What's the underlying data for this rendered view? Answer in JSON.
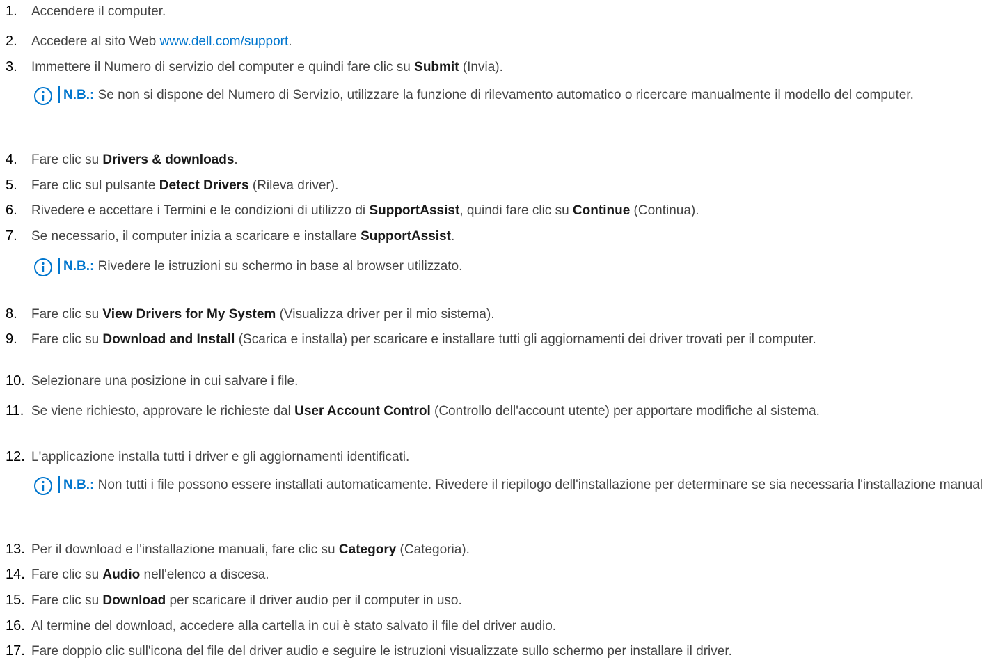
{
  "steps": [
    {
      "num": "1.",
      "segments": [
        {
          "t": "Accendere il computer."
        }
      ]
    },
    {
      "num": "2.",
      "segments": [
        {
          "t": "Accedere al sito Web "
        },
        {
          "t": "www.dell.com/support",
          "link": true
        },
        {
          "t": "."
        }
      ]
    },
    {
      "num": "3.",
      "segments": [
        {
          "t": "Immettere il Numero di servizio del computer e quindi fare clic su "
        },
        {
          "t": "Submit",
          "b": true
        },
        {
          "t": " (Invia)."
        }
      ],
      "note": {
        "label": "N.B.:",
        "text": " Se non si dispone del Numero di Servizio, utilizzare la funzione di rilevamento automatico o ricercare manualmente il modello del computer."
      }
    },
    {
      "num": "4.",
      "segments": [
        {
          "t": "Fare clic su "
        },
        {
          "t": "Drivers & downloads",
          "b": true
        },
        {
          "t": "."
        }
      ]
    },
    {
      "num": "5.",
      "segments": [
        {
          "t": "Fare clic sul pulsante "
        },
        {
          "t": "Detect Drivers",
          "b": true
        },
        {
          "t": " (Rileva driver)."
        }
      ]
    },
    {
      "num": "6.",
      "segments": [
        {
          "t": "Rivedere e accettare i Termini e le condizioni di utilizzo di "
        },
        {
          "t": "SupportAssist",
          "b": true
        },
        {
          "t": ", quindi fare clic su "
        },
        {
          "t": "Continue",
          "b": true
        },
        {
          "t": " (Continua)."
        }
      ]
    },
    {
      "num": "7.",
      "segments": [
        {
          "t": "Se necessario, il computer inizia a scaricare e installare "
        },
        {
          "t": "SupportAssist",
          "b": true
        },
        {
          "t": "."
        }
      ],
      "note": {
        "label": "N.B.:",
        "text": " Rivedere le istruzioni su schermo in base al browser utilizzato."
      }
    },
    {
      "num": "8.",
      "segments": [
        {
          "t": "Fare clic su "
        },
        {
          "t": "View Drivers for My System",
          "b": true
        },
        {
          "t": " (Visualizza driver per il mio sistema)."
        }
      ]
    },
    {
      "num": "9.",
      "segments": [
        {
          "t": "Fare clic su "
        },
        {
          "t": "Download and Install",
          "b": true
        },
        {
          "t": " (Scarica e installa) per scaricare e installare tutti gli aggiornamenti dei driver trovati per il computer."
        }
      ]
    },
    {
      "num": "10.",
      "segments": [
        {
          "t": "Selezionare una posizione in cui salvare i file."
        }
      ]
    },
    {
      "num": "11.",
      "segments": [
        {
          "t": "Se viene richiesto, approvare le richieste dal "
        },
        {
          "t": "User Account Control",
          "b": true
        },
        {
          "t": " (Controllo dell'account utente) per apportare modifiche al sistema."
        }
      ]
    },
    {
      "num": "12.",
      "segments": [
        {
          "t": "L'applicazione installa tutti i driver e gli aggiornamenti identificati."
        }
      ],
      "note": {
        "label": "N.B.:",
        "text": " Non tutti i file possono essere installati automaticamente. Rivedere il riepilogo dell'installazione per determinare se sia necessaria l'installazione manuale."
      }
    },
    {
      "num": "13.",
      "segments": [
        {
          "t": "Per il download e l'installazione manuali, fare clic su "
        },
        {
          "t": "Category",
          "b": true
        },
        {
          "t": " (Categoria)."
        }
      ]
    },
    {
      "num": "14.",
      "segments": [
        {
          "t": "Fare clic su "
        },
        {
          "t": "Audio",
          "b": true
        },
        {
          "t": " nell'elenco a discesa."
        }
      ]
    },
    {
      "num": "15.",
      "segments": [
        {
          "t": "Fare clic su "
        },
        {
          "t": "Download",
          "b": true
        },
        {
          "t": " per scaricare il driver audio per il computer in uso."
        }
      ]
    },
    {
      "num": "16.",
      "segments": [
        {
          "t": "Al termine del download, accedere alla cartella in cui è stato salvato il file del driver audio."
        }
      ]
    },
    {
      "num": "17.",
      "segments": [
        {
          "t": "Fare doppio clic sull'icona del file del driver audio e seguire le istruzioni visualizzate sullo schermo per installare il driver."
        }
      ]
    }
  ],
  "note_icon": "info-icon",
  "colors": {
    "text": "#444444",
    "accent": "#0076ce",
    "bold": "#1a1a1a",
    "number": "#000000"
  }
}
